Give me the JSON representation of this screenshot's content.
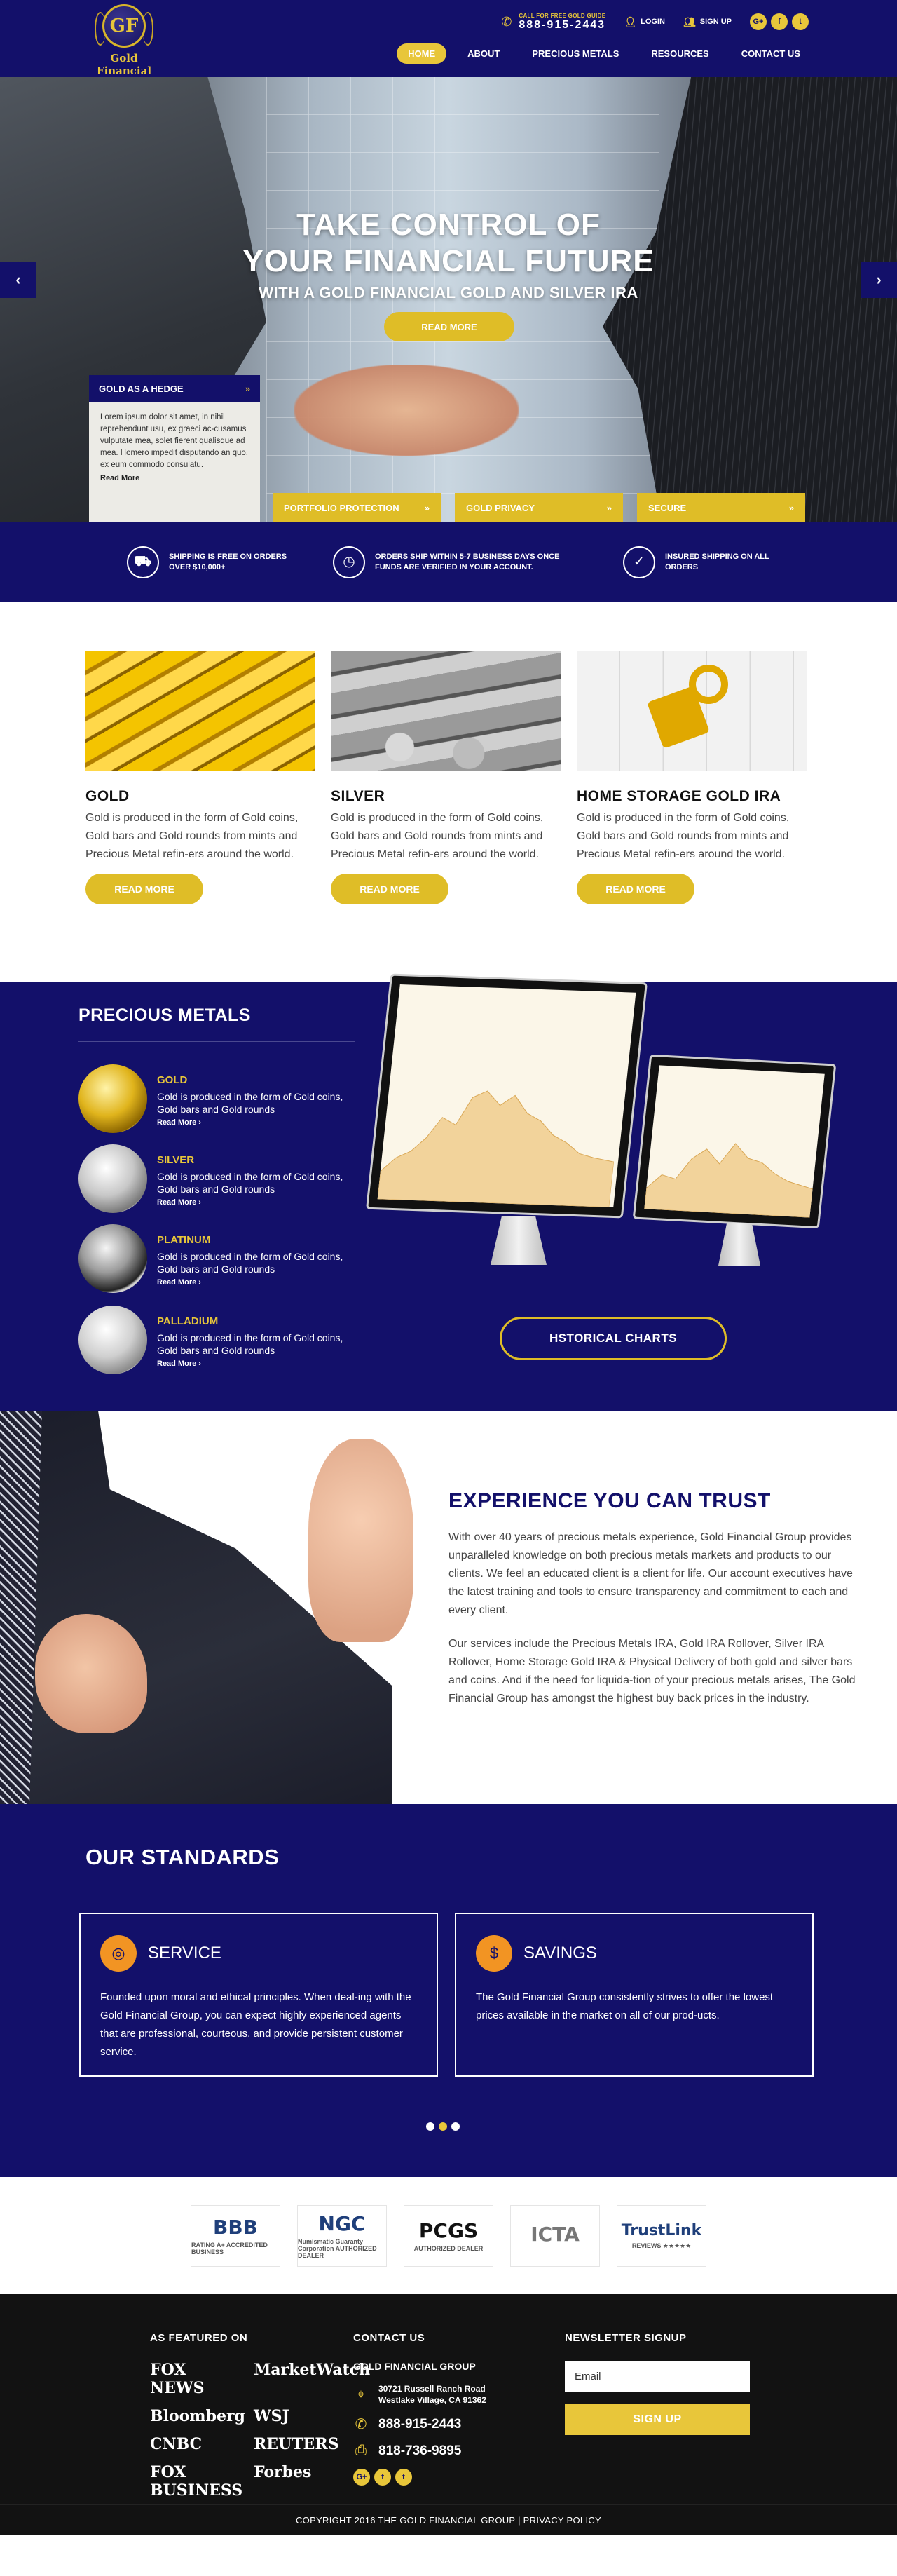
{
  "header": {
    "logo_initials": "GF",
    "logo_name": "Gold Financial",
    "logo_stars": "★★★★★",
    "call_label": "CALL FOR FREE GOLD GUIDE",
    "phone": "888-915-2443",
    "login": "LOGIN",
    "signup": "SIGN UP",
    "socials": [
      "G+",
      "f",
      "t"
    ],
    "nav": [
      {
        "label": "HOME",
        "active": true
      },
      {
        "label": "ABOUT"
      },
      {
        "label": "PRECIOUS METALS"
      },
      {
        "label": "RESOURCES"
      },
      {
        "label": "CONTACT US"
      }
    ]
  },
  "hero": {
    "line1": "TAKE CONTROL OF",
    "line2": "YOUR FINANCIAL FUTURE",
    "line3": "WITH A GOLD FINANCIAL GOLD AND SILVER IRA",
    "button": "READ MORE",
    "prev": "‹",
    "next": "›",
    "hedge": {
      "title": "GOLD AS A HEDGE",
      "body": "Lorem ipsum dolor sit amet, in nihil reprehendunt usu, ex graeci ac-cusamus vulputate mea, solet fierent qualisque ad mea. Homero impedit disputando an quo, ex eum commodo consulatu.",
      "more": "Read More"
    },
    "tabs": [
      "PORTFOLIO PROTECTION",
      "GOLD PRIVACY",
      "SECURE"
    ]
  },
  "features": [
    {
      "icon": "truck-icon",
      "glyph": "⛟",
      "text": "SHIPPING IS FREE ON ORDERS OVER $10,000+"
    },
    {
      "icon": "clock-icon",
      "glyph": "◷",
      "text": "ORDERS SHIP WITHIN 5-7 BUSINESS DAYS ONCE FUNDS ARE VERIFIED IN YOUR ACCOUNT."
    },
    {
      "icon": "shield-icon",
      "glyph": "✓",
      "text": "INSURED SHIPPING ON ALL ORDERS"
    }
  ],
  "products": [
    {
      "title": "GOLD",
      "desc": "Gold is produced in the form of Gold coins, Gold bars and Gold rounds from mints and Precious Metal refin-ers around the world.",
      "button": "READ MORE"
    },
    {
      "title": "SILVER",
      "desc": "Gold is produced in the form of Gold coins, Gold bars and Gold rounds from mints and Precious Metal refin-ers around the world.",
      "button": "READ MORE"
    },
    {
      "title": "HOME STORAGE GOLD IRA",
      "desc": "Gold is produced in the form of Gold coins, Gold bars and Gold rounds from mints and Precious Metal refin-ers around the world.",
      "button": "READ MORE"
    }
  ],
  "metals": {
    "title": "PRECIOUS METALS",
    "items": [
      {
        "name": "GOLD",
        "desc": "Gold is produced in the form of Gold coins, Gold bars and Gold rounds",
        "more": "Read More  ›"
      },
      {
        "name": "SILVER",
        "desc": "Gold is produced in the form of Gold coins, Gold bars and Gold rounds",
        "more": "Read More  ›"
      },
      {
        "name": "PLATINUM",
        "desc": "Gold is produced in the form of Gold coins, Gold bars and Gold rounds",
        "more": "Read More  ›"
      },
      {
        "name": "PALLADIUM",
        "desc": "Gold is produced in the form of Gold coins, Gold bars and Gold rounds",
        "more": "Read More  ›"
      }
    ],
    "chart_button": "HSTORICAL CHARTS"
  },
  "experience": {
    "title": "EXPERIENCE YOU CAN TRUST",
    "p1": "With over 40 years of precious metals experience, Gold Financial Group provides unparalleled knowledge on both precious metals markets and products to our clients. We feel an educated client is a client for life. Our account executives have the latest training and tools to ensure transparency and commitment to each and every client.",
    "p2": "Our services include the Precious Metals IRA, Gold IRA Rollover, Silver IRA Rollover, Home Storage Gold IRA & Physical Delivery of both gold and silver bars and coins. And if the need for liquida-tion of your precious metals arises, The Gold Financial Group has amongst the highest buy back prices in the industry."
  },
  "standards": {
    "title": "OUR STANDARDS",
    "items": [
      {
        "title": "SERVICE",
        "glyph": "◎",
        "desc": "Founded upon moral and ethical principles. When deal-ing with the Gold Financial Group, you can expect highly experienced agents that are professional, courteous, and provide persistent customer service."
      },
      {
        "title": "SAVINGS",
        "glyph": "$",
        "desc": "The Gold Financial Group consistently strives to offer the lowest prices available in the market on all of our prod-ucts."
      }
    ]
  },
  "partners": [
    {
      "big": "BBB",
      "small": "RATING A+ ACCREDITED BUSINESS"
    },
    {
      "big": "NGC",
      "small": "Numismatic Guaranty Corporation AUTHORIZED DEALER"
    },
    {
      "big": "PCGS",
      "small": "AUTHORIZED DEALER"
    },
    {
      "big": "ICTA",
      "small": ""
    },
    {
      "big": "TrustLink",
      "small": "REVIEWS ★★★★★"
    }
  ],
  "footer": {
    "featured_title": "AS FEATURED ON",
    "media": [
      "FOX NEWS",
      "MarketWatch",
      "Bloomberg",
      "WSJ",
      "CNBC",
      "REUTERS",
      "FOX BUSINESS",
      "Forbes"
    ],
    "contact_title": "CONTACT US",
    "company": "GOLD FINANCIAL GROUP",
    "address1": "30721 Russell Ranch Road",
    "address2": "Westlake Village, CA 91362",
    "phone": "888-915-2443",
    "fax": "818-736-9895",
    "newsletter_title": "NEWSLETTER SIGNUP",
    "email_placeholder": "Email",
    "signup_button": "SIGN UP",
    "copyright": "COPYRIGHT 2016 THE GOLD FINANCIAL GROUP | PRIVACY POLICY"
  }
}
